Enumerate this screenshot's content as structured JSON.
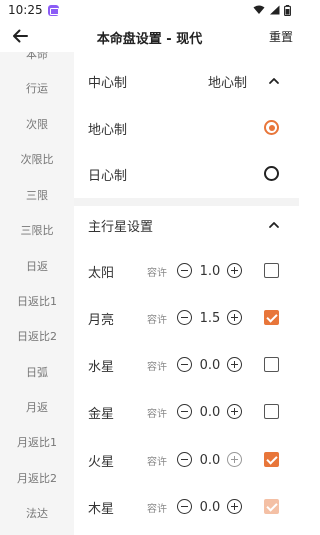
{
  "status_bar": {
    "time": "10:25"
  },
  "app_bar": {
    "title": "本命盘设置 - 现代",
    "reset_label": "重置"
  },
  "sidebar": {
    "items": [
      "本命",
      "行运",
      "次限",
      "次限比",
      "三限",
      "三限比",
      "日返",
      "日返比1",
      "日返比2",
      "日弧",
      "月返",
      "月返比1",
      "月返比2",
      "法达"
    ]
  },
  "center_system": {
    "title": "中心制",
    "value": "地心制",
    "expanded": true,
    "options": [
      {
        "label": "地心制",
        "selected": true
      },
      {
        "label": "日心制",
        "selected": false
      }
    ]
  },
  "main_planets": {
    "title": "主行星设置",
    "expanded": true,
    "tolerance_label": "容许",
    "planets": [
      {
        "name": "太阳",
        "tolerance": "1.0",
        "checked": false
      },
      {
        "name": "月亮",
        "tolerance": "1.5",
        "checked": true
      },
      {
        "name": "水星",
        "tolerance": "0.0",
        "checked": false
      },
      {
        "name": "金星",
        "tolerance": "0.0",
        "checked": false
      },
      {
        "name": "火星",
        "tolerance": "0.0",
        "checked": true
      },
      {
        "name": "木星",
        "tolerance": "0.0",
        "checked": true
      }
    ]
  },
  "colors": {
    "accent": "#e8763a",
    "sidebar_bg": "#f5f5f5",
    "divider": "#f3f3f3"
  }
}
